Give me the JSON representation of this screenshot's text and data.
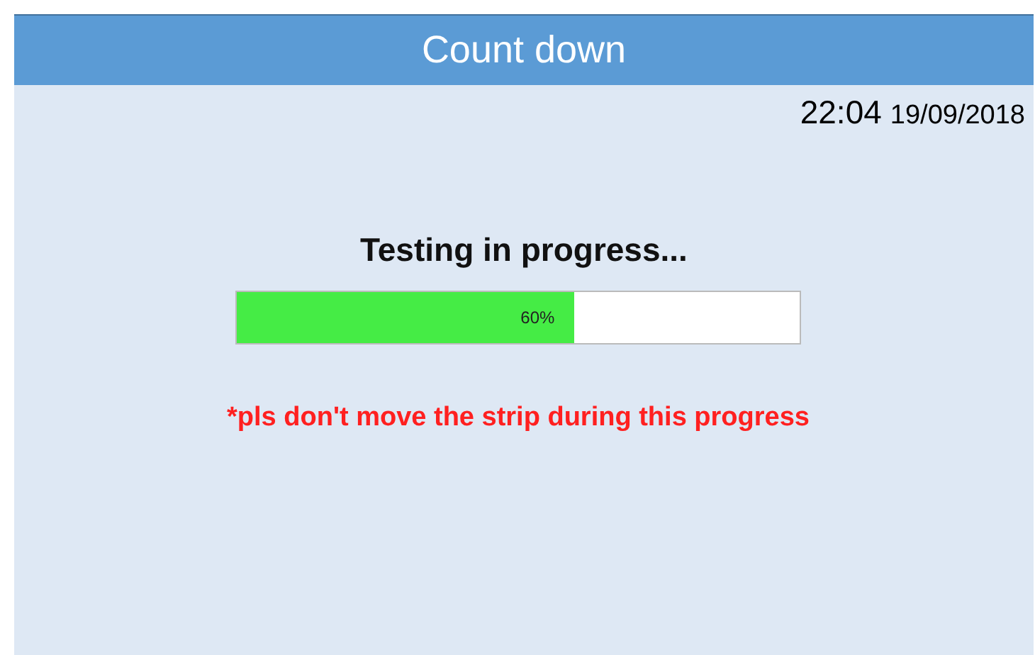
{
  "window": {
    "title": "Count down"
  },
  "clock": {
    "time": "22:04",
    "date": "19/09/2018"
  },
  "status": {
    "heading": "Testing in progress...",
    "progress": {
      "level": 0.6,
      "label": "60%"
    },
    "warning": "*pls don't move the strip during this progress"
  }
}
